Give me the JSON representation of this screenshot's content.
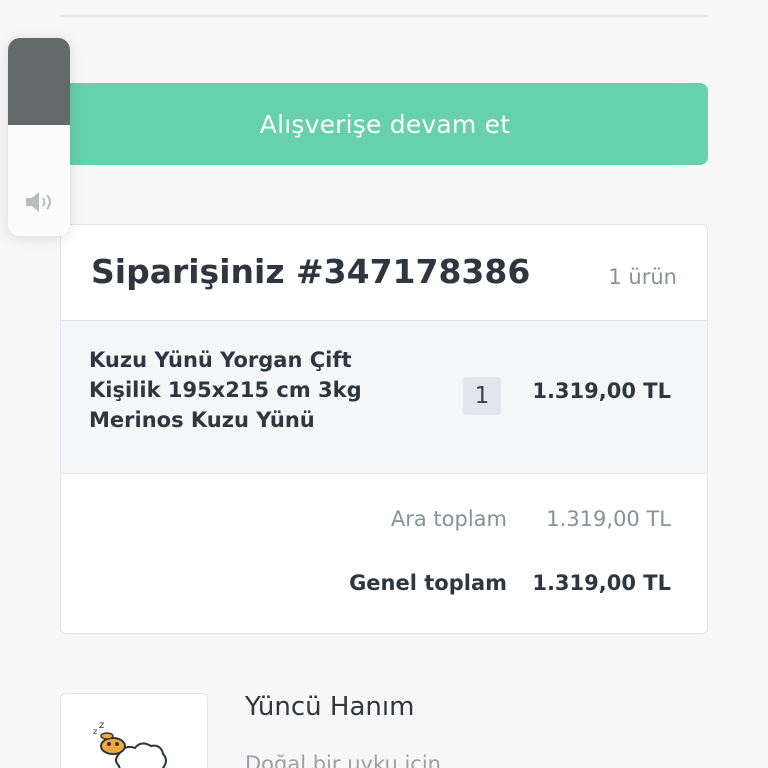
{
  "actions": {
    "continue_shopping_label": "Alışverişe devam et"
  },
  "order": {
    "title": "Siparişiniz #347178386",
    "item_count": "1 ürün",
    "items": [
      {
        "name": "Kuzu Yünü Yorgan Çift Kişilik 195x215 cm 3kg Merinos Kuzu Yünü",
        "quantity": "1",
        "price": "1.319,00 TL"
      }
    ],
    "subtotal_label": "Ara toplam",
    "subtotal_value": "1.319,00 TL",
    "total_label": "Genel toplam",
    "total_value": "1.319,00 TL"
  },
  "store": {
    "name": "Yüncü Hanım",
    "description": "Doğal bir uyku için"
  },
  "volume_hud": {
    "level_fraction": 0.44,
    "icon": "speaker-icon"
  },
  "colors": {
    "accent": "#66d1ac",
    "text_dark": "#2f3640",
    "text_muted": "#8a9099",
    "hud_fill": "#636a69"
  }
}
